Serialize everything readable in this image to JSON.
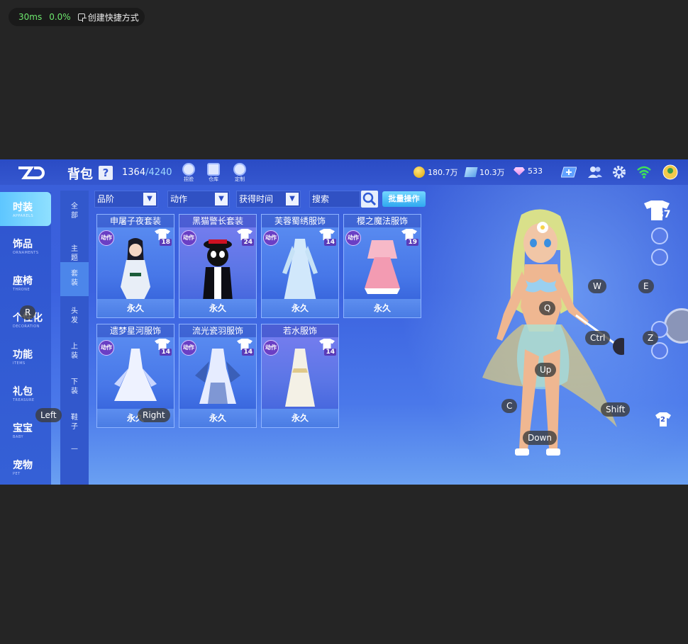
{
  "perf": {
    "latency": "30ms",
    "loss": "0.0%",
    "shortcut_label": "创建快捷方式"
  },
  "topbar": {
    "title": "背包",
    "help": "?",
    "capacity_used": "1364",
    "capacity_max": "/4240",
    "tools": [
      {
        "label": "捏脸",
        "icon": "face-icon"
      },
      {
        "label": "仓库",
        "icon": "warehouse-icon"
      },
      {
        "label": "定制",
        "icon": "custom-icon"
      }
    ],
    "currencies": [
      {
        "value": "180.7万",
        "icon": "gold-coin-icon"
      },
      {
        "value": "10.3万",
        "icon": "ticket-icon"
      },
      {
        "value": "533",
        "icon": "diamond-icon"
      }
    ]
  },
  "leftnav": {
    "items": [
      {
        "cn": "时装",
        "en": "APPARELS",
        "active": true
      },
      {
        "cn": "饰品",
        "en": "ORNAMENTS"
      },
      {
        "cn": "座椅",
        "en": "THRONE"
      },
      {
        "cn": "个性化",
        "en": "DECORATION"
      },
      {
        "cn": "功能",
        "en": "ITEMS"
      },
      {
        "cn": "礼包",
        "en": "TREASURE"
      },
      {
        "cn": "宝宝",
        "en": "BABY"
      },
      {
        "cn": "宠物",
        "en": "PET"
      }
    ]
  },
  "subnav": {
    "items": [
      {
        "label": "全部"
      },
      {
        "label": "主题"
      },
      {
        "label": "套装",
        "active": true
      },
      {
        "label": "头发"
      },
      {
        "label": "上装"
      },
      {
        "label": "下装"
      },
      {
        "label": "鞋子"
      },
      {
        "label": "—"
      }
    ]
  },
  "filters": {
    "grade": "品阶",
    "action": "动作",
    "obtain_time": "获得时间",
    "search_placeholder": "搜索",
    "bulk_label": "批量操作"
  },
  "cards": [
    {
      "title": "申屠子夜套装",
      "tag": "动作",
      "level": "18",
      "duration": "永久"
    },
    {
      "title": "黑猫警长套装",
      "tag": "动作",
      "level": "24",
      "duration": "永久"
    },
    {
      "title": "芙蓉蜀绣服饰",
      "tag": "动作",
      "level": "14",
      "duration": "永久"
    },
    {
      "title": "樱之魔法服饰",
      "tag": "动作",
      "level": "19",
      "duration": "永久"
    },
    {
      "title": "遗梦星河服饰",
      "tag": "动作",
      "level": "14",
      "duration": "永久"
    },
    {
      "title": "流光瓷羽服饰",
      "tag": "动作",
      "level": "14",
      "duration": "永久"
    },
    {
      "title": "若水服饰",
      "tag": "动作",
      "level": "14",
      "duration": "永久"
    }
  ],
  "character": {
    "outfit_level": "87",
    "wardrobe_slot": "2"
  },
  "keys": {
    "R": "R",
    "Left": "Left",
    "Right": "Right",
    "W": "W",
    "E": "E",
    "Q": "Q",
    "Ctrl": "Ctrl",
    "Z": "Z",
    "Up": "Up",
    "C": "C",
    "Shift": "Shift",
    "Down": "Down"
  },
  "colors": {
    "accent": "#3f68e0",
    "bulk": "#2fa8f0",
    "active_nav": "#5ec6ff"
  }
}
